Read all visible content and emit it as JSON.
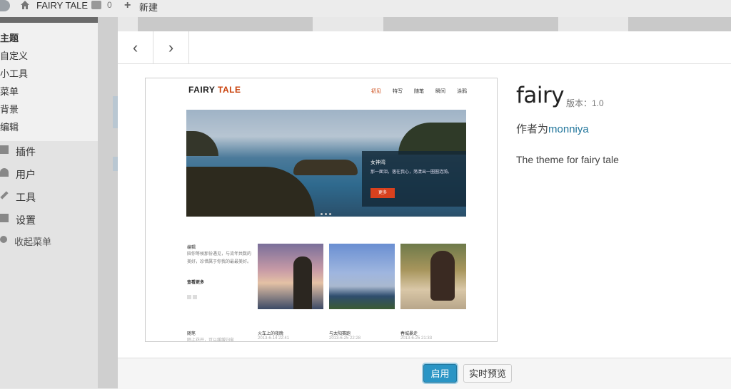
{
  "adminbar": {
    "site_name": "FAIRY TALE",
    "comment_count": "0",
    "new_label": "新建"
  },
  "menu": {
    "submenu": [
      "主题",
      "自定义",
      "小工具",
      "菜单",
      "背景",
      "编辑"
    ],
    "items": [
      {
        "label": "插件",
        "icon": "plugin-icon"
      },
      {
        "label": "用户",
        "icon": "users-icon"
      },
      {
        "label": "工具",
        "icon": "tools-icon"
      },
      {
        "label": "设置",
        "icon": "settings-icon"
      }
    ],
    "collapse_label": "收起菜单"
  },
  "nav": {
    "prev": "‹",
    "next": "›"
  },
  "screenshot": {
    "logo_a": "FAIRY ",
    "logo_b": "TALE",
    "nav": [
      "初见",
      "特写",
      "随笔",
      "瞬间",
      "涂鸦"
    ],
    "hero_title": "女神湾",
    "hero_desc": "那一面泪，落在我心，荡漾出一圈圈涟漪。",
    "hero_button": "更多",
    "blurb_title": "编辑",
    "blurb_desc": "陪你等候那份遇见，与流年共数的美好，珍惜属于你我的最最美好。",
    "blurb_more": "查看更多",
    "posts": [
      {
        "title": "随笔",
        "date": "陌上花开，可以缓缓归矣"
      },
      {
        "title": "火车上的夜晚",
        "date": "2013-6-14 22:41"
      },
      {
        "title": "与太阳赛跑",
        "date": "2013-6-25 22:28"
      },
      {
        "title": "春城暴走",
        "date": "2013-6-25 21:33"
      }
    ]
  },
  "theme": {
    "name": "fairy",
    "version": "版本：1.0",
    "author_prefix": "作者为",
    "author": "monniya",
    "description": "The theme for fairy tale"
  },
  "footer": {
    "activate": "启用",
    "preview": "实时预览"
  },
  "colors": {
    "accent": "#2a95c5",
    "link": "#21759b",
    "brand": "#c9420c"
  }
}
